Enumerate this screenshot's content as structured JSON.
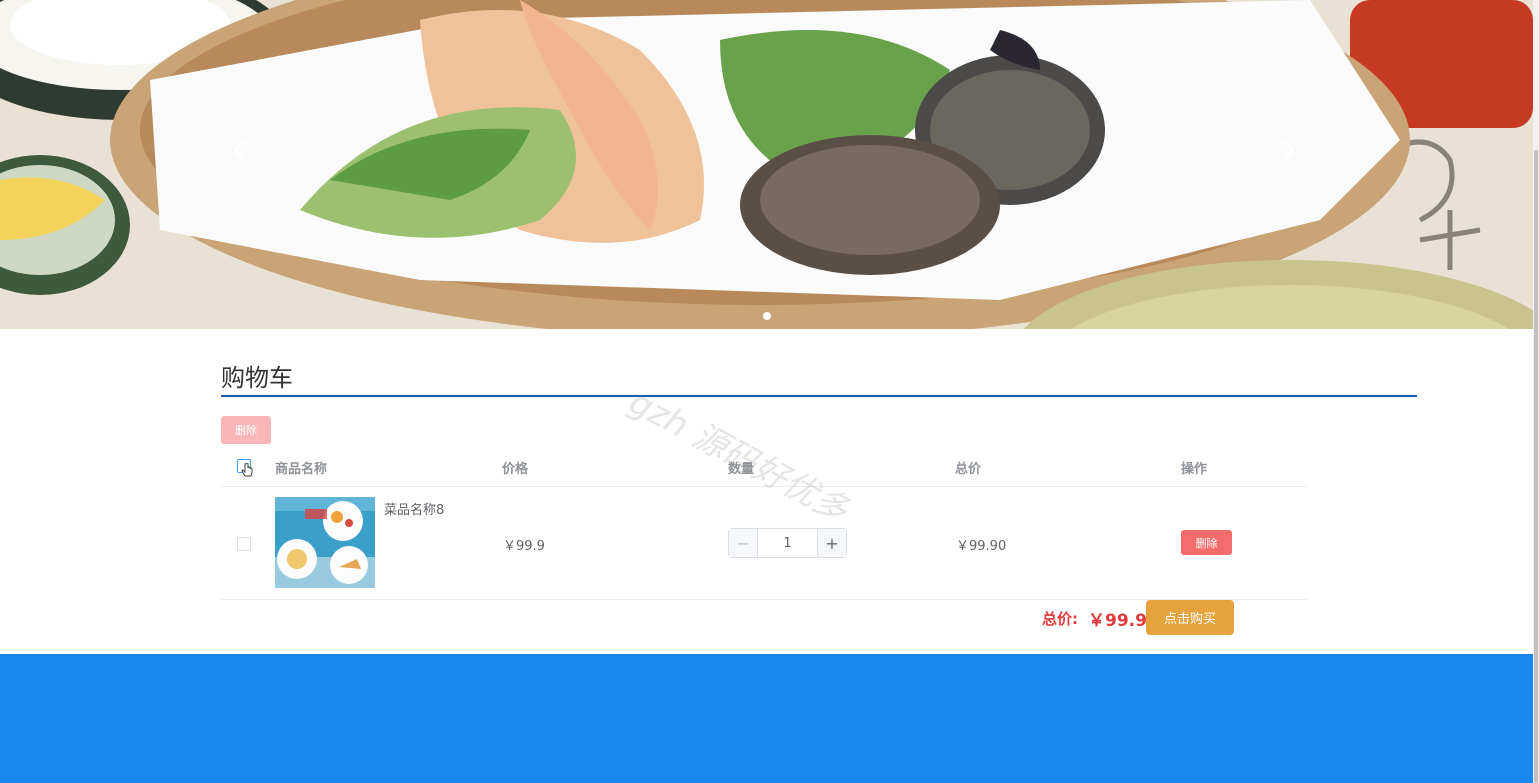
{
  "banner": {
    "prev_icon": "chevron-left-icon",
    "next_icon": "chevron-right-icon",
    "active_dot": 1,
    "dot_count": 1
  },
  "cart": {
    "title": "购物车",
    "delete_selected_label": "删除",
    "columns": [
      "商品名称",
      "价格",
      "数量",
      "总价",
      "操作"
    ],
    "items": [
      {
        "name": "菜品名称8",
        "price": "￥99.9",
        "quantity": "1",
        "subtotal": "￥99.90",
        "delete_label": "删除"
      }
    ],
    "total_label": "总价:",
    "total_value": "￥99.90",
    "buy_label": "点击购买"
  },
  "watermark": "gzh 源码好优多",
  "colors": {
    "accent_line": "#1b5fb8",
    "danger": "#f56c6c",
    "danger_light": "#fab6b6",
    "warning": "#e6a23c",
    "total_red": "#e4393c",
    "footer_blue": "#1a86f0"
  }
}
